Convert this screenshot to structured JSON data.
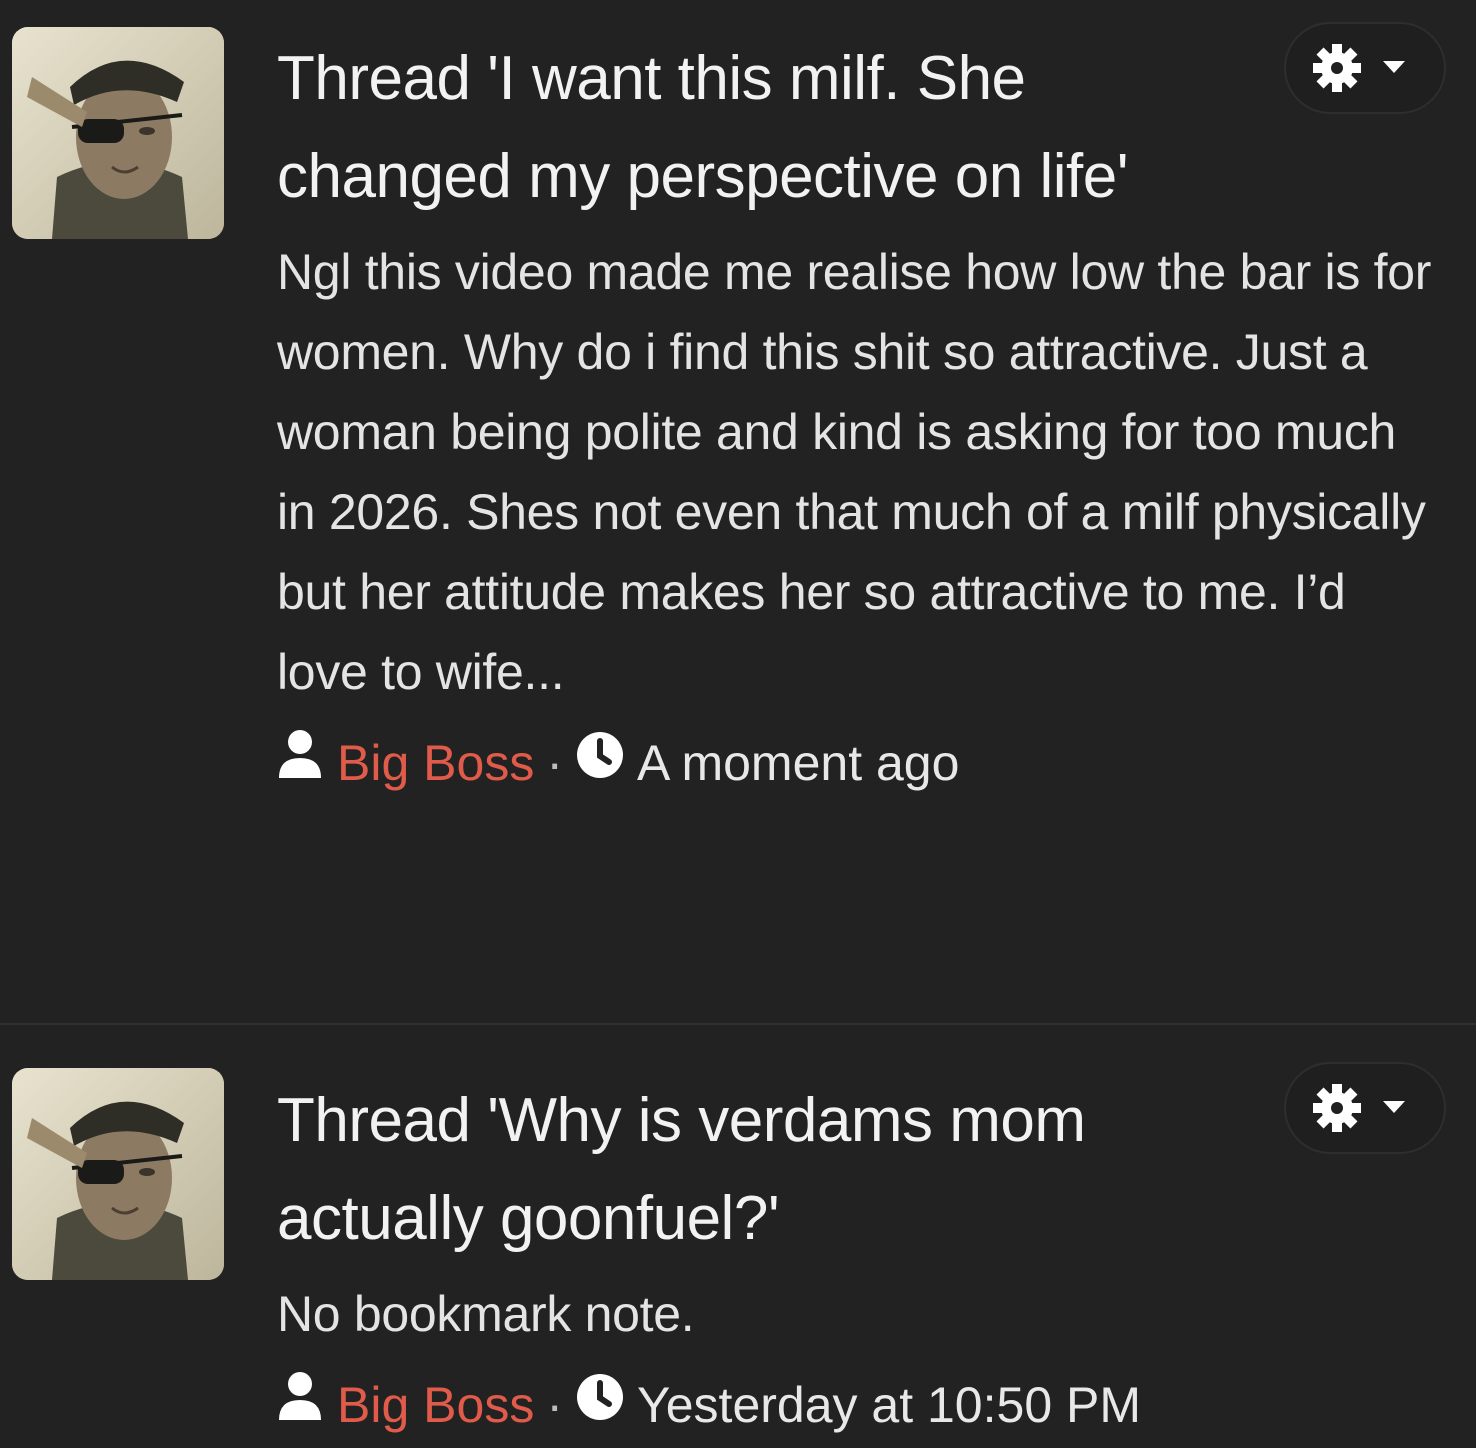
{
  "bookmarks": [
    {
      "title": "Thread 'I want this milf. She changed my perspective on life'",
      "snippet": "Ngl this video made me realise how low the bar is for women. Why do i find this shit so attractive. Just a woman being polite and kind is asking for too much in 2026. Shes not even that much of a milf physically but her attitude makes her so attractive to me. I’d love to wife...",
      "author": "Big Boss",
      "separator": "·",
      "time": "A moment ago",
      "user_icon": "user-icon",
      "time_icon": "clock-icon",
      "menu_icon": "gear-icon"
    },
    {
      "title": "Thread 'Why is verdams mom actually goonfuel?'",
      "snippet": "No bookmark note.",
      "author": "Big Boss",
      "separator": "·",
      "time": "Yesterday at 10:50 PM",
      "user_icon": "user-icon",
      "time_icon": "clock-icon",
      "menu_icon": "gear-icon"
    }
  ],
  "colors": {
    "background": "#222222",
    "text": "#ececec",
    "username": "#e05b4a",
    "button_bg": "#1f1f1f"
  }
}
